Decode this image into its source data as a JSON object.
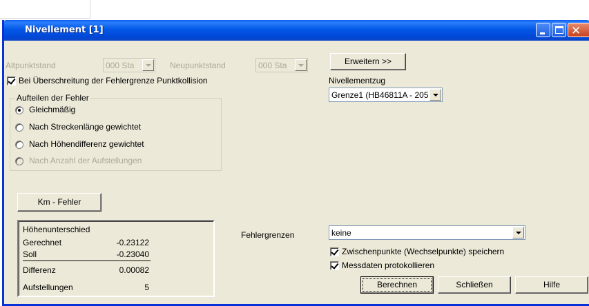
{
  "window": {
    "title": "Nivellement [1]"
  },
  "stations": {
    "altpunktstand_label": "Altpunktstand",
    "altpunktstand_value": "000   Sta",
    "neupunktstand_label": "Neupunktstand",
    "neupunktstand_value": "000   Sta"
  },
  "buttons": {
    "erweitern": "Erweitern >>",
    "km_fehler": "Km - Fehler",
    "berechnen": "Berechnen",
    "schliessen": "Schließen",
    "hilfe": "Hilfe"
  },
  "options": {
    "punktkollision_label": "Bei Überschreitung der Fehlergrenze Punktkollision",
    "zwischenpunkte_label": "Zwischenpunkte (Wechselpunkte) speichern",
    "messdaten_label": "Messdaten protokollieren"
  },
  "nivellementzug": {
    "label": "Nivellementzug",
    "value": "Grenze1 (HB46811A - 205"
  },
  "aufteilen": {
    "title": "Aufteilen der Fehler",
    "options": [
      "Gleichmäßig",
      "Nach Streckenlänge gewichtet",
      "Nach Höhendifferenz gewichtet",
      "Nach Anzahl der Aufstellungen"
    ]
  },
  "hoehen": {
    "title": "Höhenunterschied",
    "gerechnet_label": "Gerechnet",
    "gerechnet_value": "-0.23122",
    "soll_label": "Soll",
    "soll_value": "-0.23040",
    "differenz_label": "Differenz",
    "differenz_value": "0.00082",
    "aufstellungen_label": "Aufstellungen",
    "aufstellungen_value": "5"
  },
  "fehlergrenzen": {
    "label": "Fehlergrenzen",
    "value": "keine"
  }
}
